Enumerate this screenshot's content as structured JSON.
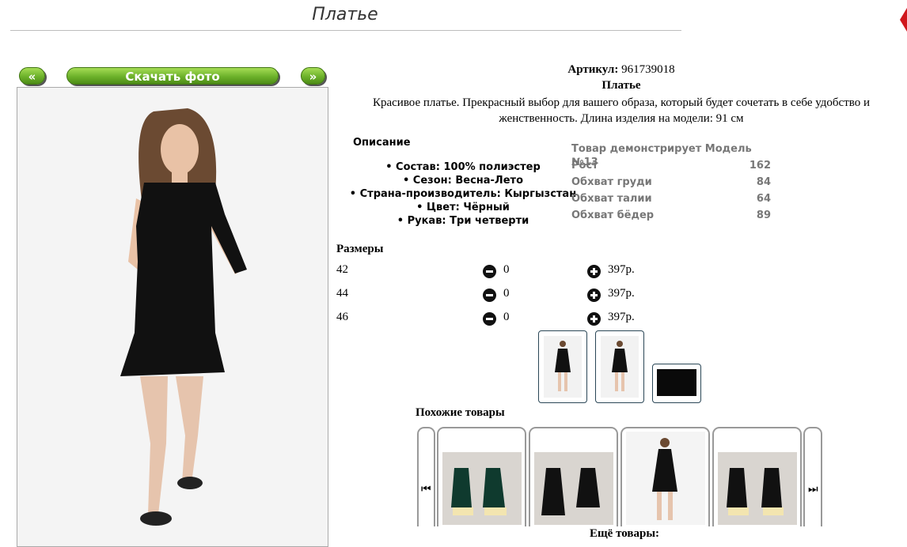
{
  "page": {
    "title": "Платье"
  },
  "gallery": {
    "prev_label": "«",
    "download_label": "Скачать фото",
    "next_label": "»"
  },
  "product": {
    "article_label": "Артикул:",
    "article": "961739018",
    "name": "Платье",
    "description": "Красивое платье. Прекрасный выбор для вашего образа, который будет сочетать в себе удобство и женственность. Длина изделия на модели: 91 см"
  },
  "description_block": {
    "title": "Описание",
    "specs": [
      "• Состав: 100% полиэстер",
      "• Сезон: Весна-Лето",
      "• Страна-производитель: Кыргызстан",
      "• Цвет: Чёрный",
      "• Рукав: Три четверти"
    ]
  },
  "model": {
    "heading": "Товар демонстрирует Модель №13",
    "rows": [
      {
        "label": "Рост",
        "value": "162"
      },
      {
        "label": "Обхват груди",
        "value": "84"
      },
      {
        "label": "Обхват талии",
        "value": "64"
      },
      {
        "label": "Обхват бёдер",
        "value": "89"
      }
    ]
  },
  "sizes": {
    "title": "Размеры",
    "rows": [
      {
        "size": "42",
        "qty": "0",
        "price": "397р."
      },
      {
        "size": "44",
        "qty": "0",
        "price": "397р."
      },
      {
        "size": "46",
        "qty": "0",
        "price": "397р."
      }
    ]
  },
  "similar": {
    "title": "Похожие товары",
    "prev_icon": "⏮",
    "next_icon": "⏭"
  },
  "more": {
    "title": "Ещё товары:"
  },
  "colors": {
    "button_green": "#6cb12a",
    "thumb_border": "#2b4757",
    "accent_red": "#d0161c"
  }
}
